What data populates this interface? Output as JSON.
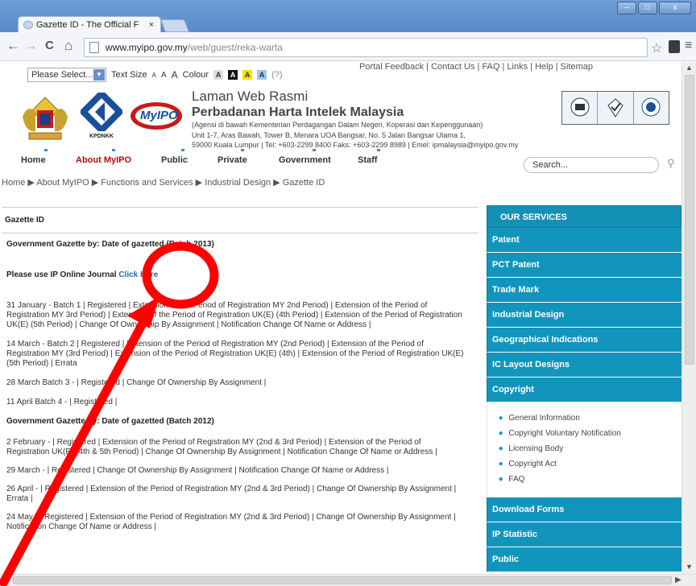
{
  "browser": {
    "tab_title": "Gazette ID - The Official F",
    "tab_close": "×",
    "url_host": "www.myipo.gov.my",
    "url_path": "/web/guest/reka-warta",
    "back": "←",
    "forward": "→",
    "reload": "C",
    "home": "⌂",
    "star": "☆",
    "menu": "≡",
    "win_min": "–",
    "win_max": "□",
    "win_close": "x"
  },
  "top_links": "Portal Feedback | Contact Us | FAQ | Links | Help | Sitemap",
  "controls": {
    "select": "Please Select...",
    "text_size": "Text Size",
    "sizes": [
      "A",
      "A",
      "A"
    ],
    "colour": "Colour",
    "swatches": [
      "A",
      "A",
      "A",
      "A"
    ],
    "help": "(?)"
  },
  "header": {
    "kpdnkk": "KPDNKK",
    "myipo": "MyIPO",
    "title1": "Laman Web Rasmi",
    "title2": "Perbadanan Harta Intelek Malaysia",
    "title3": "(Agensi di bawah Kementerian Perdagangan Dalam Negeri, Koperasi dan Kepenggunaan)",
    "title4": "Unit 1-7, Aras Bawah, Tower B, Menara UOA Bangsar, No. 5 Jalan Bangsar Utama 1,",
    "title5": "59000 Kuala Lumpur | Tel: +603-2299 8400 Faks: +603-2299 8989 | Emel: ipmalaysia@myipo.gov.my"
  },
  "nav": [
    "Home",
    "About MyIPO",
    "Public",
    "Private",
    "Government",
    "Staff"
  ],
  "search_placeholder": "Search...",
  "breadcrumb": "Home ▶ About MyIPO ▶ Functions and Services ▶ Industrial Design ▶ Gazette ID",
  "content": {
    "heading": "Gazette ID",
    "gazette_2013": "Government Gazette by: Date of gazetted (Batch 2013)",
    "ip_journal": "Please use IP Online Journal",
    "click_here": "Click Here",
    "p1": "31 January - Batch 1 | Registered | Extension of the Period of Registration MY 2nd Period) | Extension of the Period of Registration MY 3rd Period) | Extension of the Period of Registration UK(E) (4th Period) | Extension of the Period of Registration UK(E) (5th Period) | Change Of Ownership By Assignment | Notification Change Of Name or Address |",
    "p2": "14 March - Batch 2 | Registered | Extension of the Period of Registration MY (2nd Period) | Extension of the Period of Registration MY (3rd Period) | Extension of the Period of Registration UK(E) (4th) | Extension of the Period of Registration UK(E) (5th Period) | Errata",
    "p3": "28 March  Batch 3 - | Registered | Change Of Ownership By Assignment |",
    "p4": "11 April  Batch 4 - | Registered |",
    "gazette_2012": "Government Gazette by: Date of gazetted (Batch 2012)",
    "p5": "2 February - | Registered | Extension of the Period of Registration MY (2nd & 3rd Period) | Extension of the Period of Registration UK(E) (4th & 5th Period) | Change Of Ownership By Assignment | Notification Change Of Name or Address |",
    "p6": "29 March - | Registered | Change Of Ownership By Assignment | Notification Change Of Name or Address |",
    "p7": "26 April - | Registered | Extension of the Period of Registration MY (2nd & 3rd Period) | Change Of Ownership By Assignment | Errata |",
    "p8": "24 May - | Registered | Extension of the Period of Registration MY (2nd & 3rd Period) | Change Of Ownership By Assignment | Notification Change Of Name or Address |"
  },
  "sidebar": {
    "header": "OUR SERVICES",
    "items": [
      "Patent",
      "PCT Patent",
      "Trade Mark",
      "Industrial Design",
      "Geographical Indications",
      "IC Layout Designs",
      "Copyright"
    ],
    "copyright_sub": [
      "General Information",
      "Copyright Voluntary Notification",
      "Licensing Body",
      "Copyright Act",
      "FAQ"
    ],
    "bottom_items": [
      "Download Forms",
      "IP Statistic",
      "Public"
    ]
  },
  "colors": {
    "accent": "#1295bd",
    "annotation": "#ff0000",
    "nav_active": "#b10d0d"
  }
}
